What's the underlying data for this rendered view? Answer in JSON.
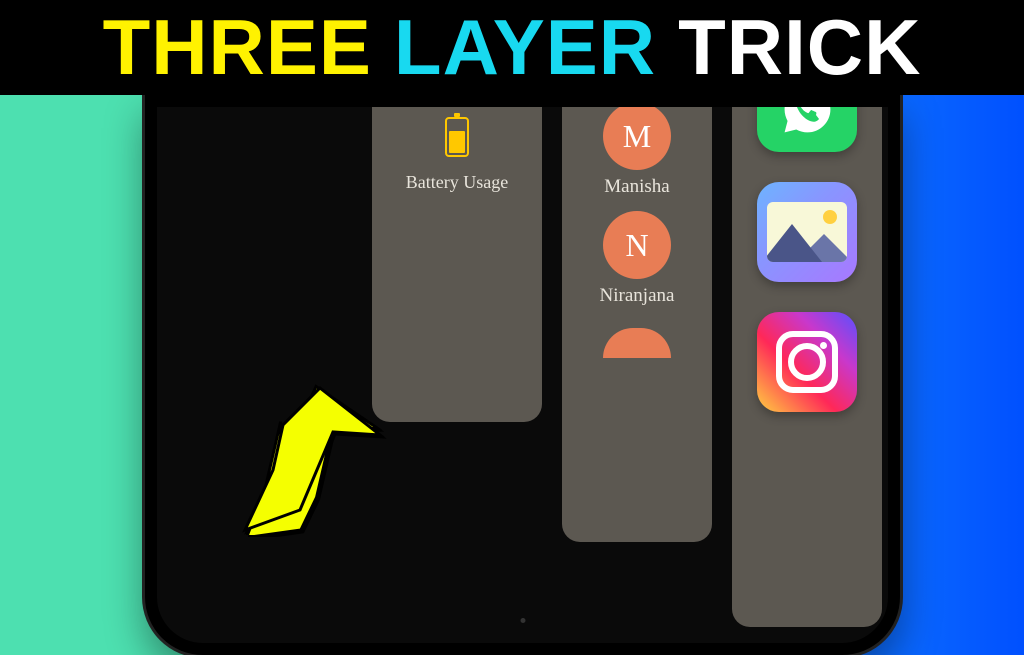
{
  "title": {
    "word1": "THREE",
    "word2": "LAYER",
    "word3": "TRICK"
  },
  "layer1": {
    "label": "Battery Usage"
  },
  "layer2": {
    "contacts": [
      {
        "initial": "M",
        "name": "Manisha"
      },
      {
        "initial": "N",
        "name": "Niranjana"
      }
    ]
  },
  "layer3": {
    "apps": [
      "whatsapp",
      "gallery",
      "instagram"
    ]
  },
  "colors": {
    "title_yellow": "#fff200",
    "title_cyan": "#18d9f0",
    "avatar_bg": "#e87d55",
    "battery": "#ffc800",
    "arrow": "#f5ff00"
  }
}
